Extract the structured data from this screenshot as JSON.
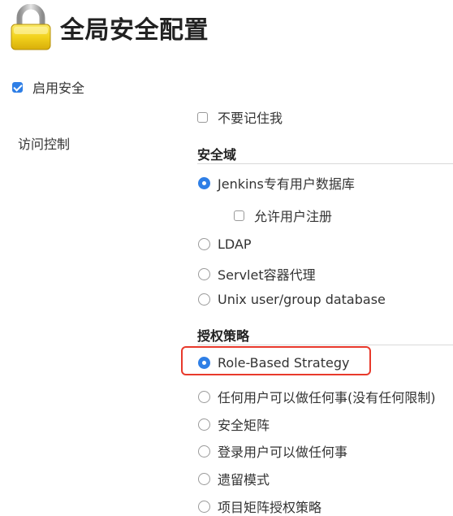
{
  "page": {
    "title": "全局安全配置",
    "icon": "lock-icon"
  },
  "enable_security": {
    "label": "启用安全",
    "checked": true
  },
  "access_control": {
    "label": "访问控制",
    "remember_me": {
      "label": "不要记住我",
      "checked": false
    },
    "security_realm": {
      "heading": "安全域",
      "options": [
        {
          "label": "Jenkins专有用户数据库",
          "selected": true
        },
        {
          "label": "LDAP",
          "selected": false
        },
        {
          "label": "Servlet容器代理",
          "selected": false
        },
        {
          "label": "Unix user/group database",
          "selected": false
        }
      ],
      "allow_signup": {
        "label": "允许用户注册",
        "checked": false
      }
    },
    "authorization": {
      "heading": "授权策略",
      "options": [
        {
          "label": "Role-Based Strategy",
          "selected": true
        },
        {
          "label": "任何用户可以做任何事(没有任何限制)",
          "selected": false
        },
        {
          "label": "安全矩阵",
          "selected": false
        },
        {
          "label": "登录用户可以做任何事",
          "selected": false
        },
        {
          "label": "遗留模式",
          "selected": false
        },
        {
          "label": "项目矩阵授权策略",
          "selected": false
        }
      ]
    }
  },
  "colors": {
    "accent": "#2f7fe6",
    "highlight": "#e8392b",
    "lock_body": "#f2d21c"
  }
}
